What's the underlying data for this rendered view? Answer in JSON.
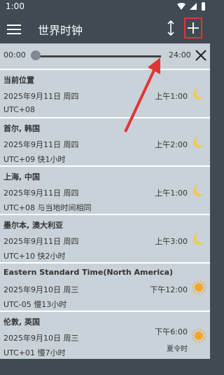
{
  "status": {
    "time": "1:00"
  },
  "appbar": {
    "title": "世界时钟",
    "add_label": "+"
  },
  "slider": {
    "start": "00:00",
    "end": "24:00",
    "value_fraction": 0.0
  },
  "cities": [
    {
      "name": "当前位置",
      "date": "2025年9月11日 周四",
      "utc": "UTC+08",
      "time": "上午1:00",
      "icon": "moon-icon"
    },
    {
      "name": "首尔, 韩国",
      "date": "2025年9月11日 周四",
      "utc": "UTC+09 快1小时",
      "time": "上午2:00",
      "icon": "moon-icon"
    },
    {
      "name": "上海, 中国",
      "date": "2025年9月11日 周四",
      "utc": "UTC+08 与当地时间相同",
      "time": "上午1:00",
      "icon": "moon-icon"
    },
    {
      "name": "墨尔本, 澳大利亚",
      "date": "2025年9月11日 周四",
      "utc": "UTC+10 快2小时",
      "time": "上午3:00",
      "icon": "moon-icon"
    },
    {
      "name": "Eastern Standard Time(North America)",
      "date": "2025年9月10日 周三",
      "utc": "UTC-05 慢13小时",
      "time": "下午12:00",
      "icon": "sun-icon"
    },
    {
      "name": "伦敦, 英国",
      "date": "2025年9月10日 周三",
      "utc": "UTC+01 慢7小时",
      "time": "下午6:00",
      "icon": "sun-icon",
      "dst": "夏令时"
    }
  ]
}
